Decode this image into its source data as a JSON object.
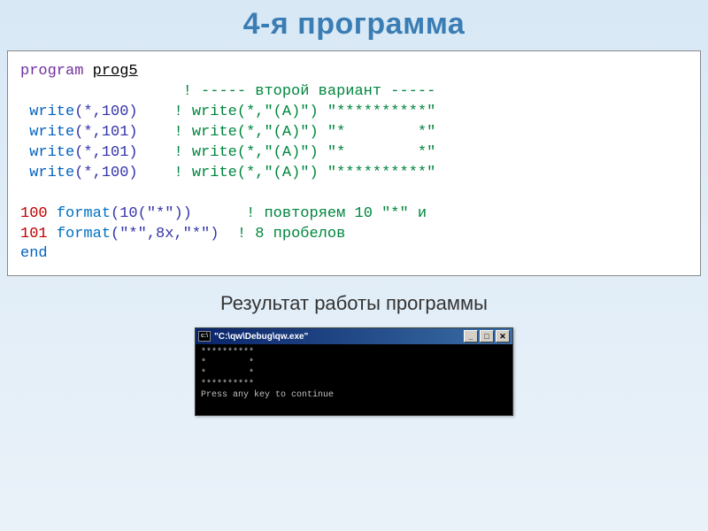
{
  "title": "4-я программа",
  "code": {
    "l1_kw": "program",
    "l1_name": "prog5",
    "l2_comment": "! ----- второй вариант -----",
    "l3a": "write",
    "l3b": "(*,100)",
    "l3c": "! write(*,\"(A)\") \"**********\"",
    "l4a": "write",
    "l4b": "(*,101)",
    "l4c": "! write(*,\"(A)\") \"*        *\"",
    "l5a": "write",
    "l5b": "(*,101)",
    "l5c": "! write(*,\"(A)\") \"*        *\"",
    "l6a": "write",
    "l6b": "(*,100)",
    "l6c": "! write(*,\"(A)\") \"**********\"",
    "l7n": "100",
    "l7f": "format",
    "l7a": "(10(\"*\"))",
    "l7c": "! повторяем 10 \"*\" и",
    "l8n": "101",
    "l8f": "format",
    "l8a": "(\"*\",8x,\"*\")",
    "l8c": "! 8 пробелов",
    "l9": "end"
  },
  "subtitle": "Результат работы программы",
  "console": {
    "title": "\"C:\\qw\\Debug\\qw.exe\"",
    "icon_text": "c:\\",
    "btn_min": "_",
    "btn_max": "□",
    "btn_close": "✕",
    "out1": "**********",
    "out2": "*        *",
    "out3": "*        *",
    "out4": "**********",
    "out5": "Press any key to continue"
  }
}
